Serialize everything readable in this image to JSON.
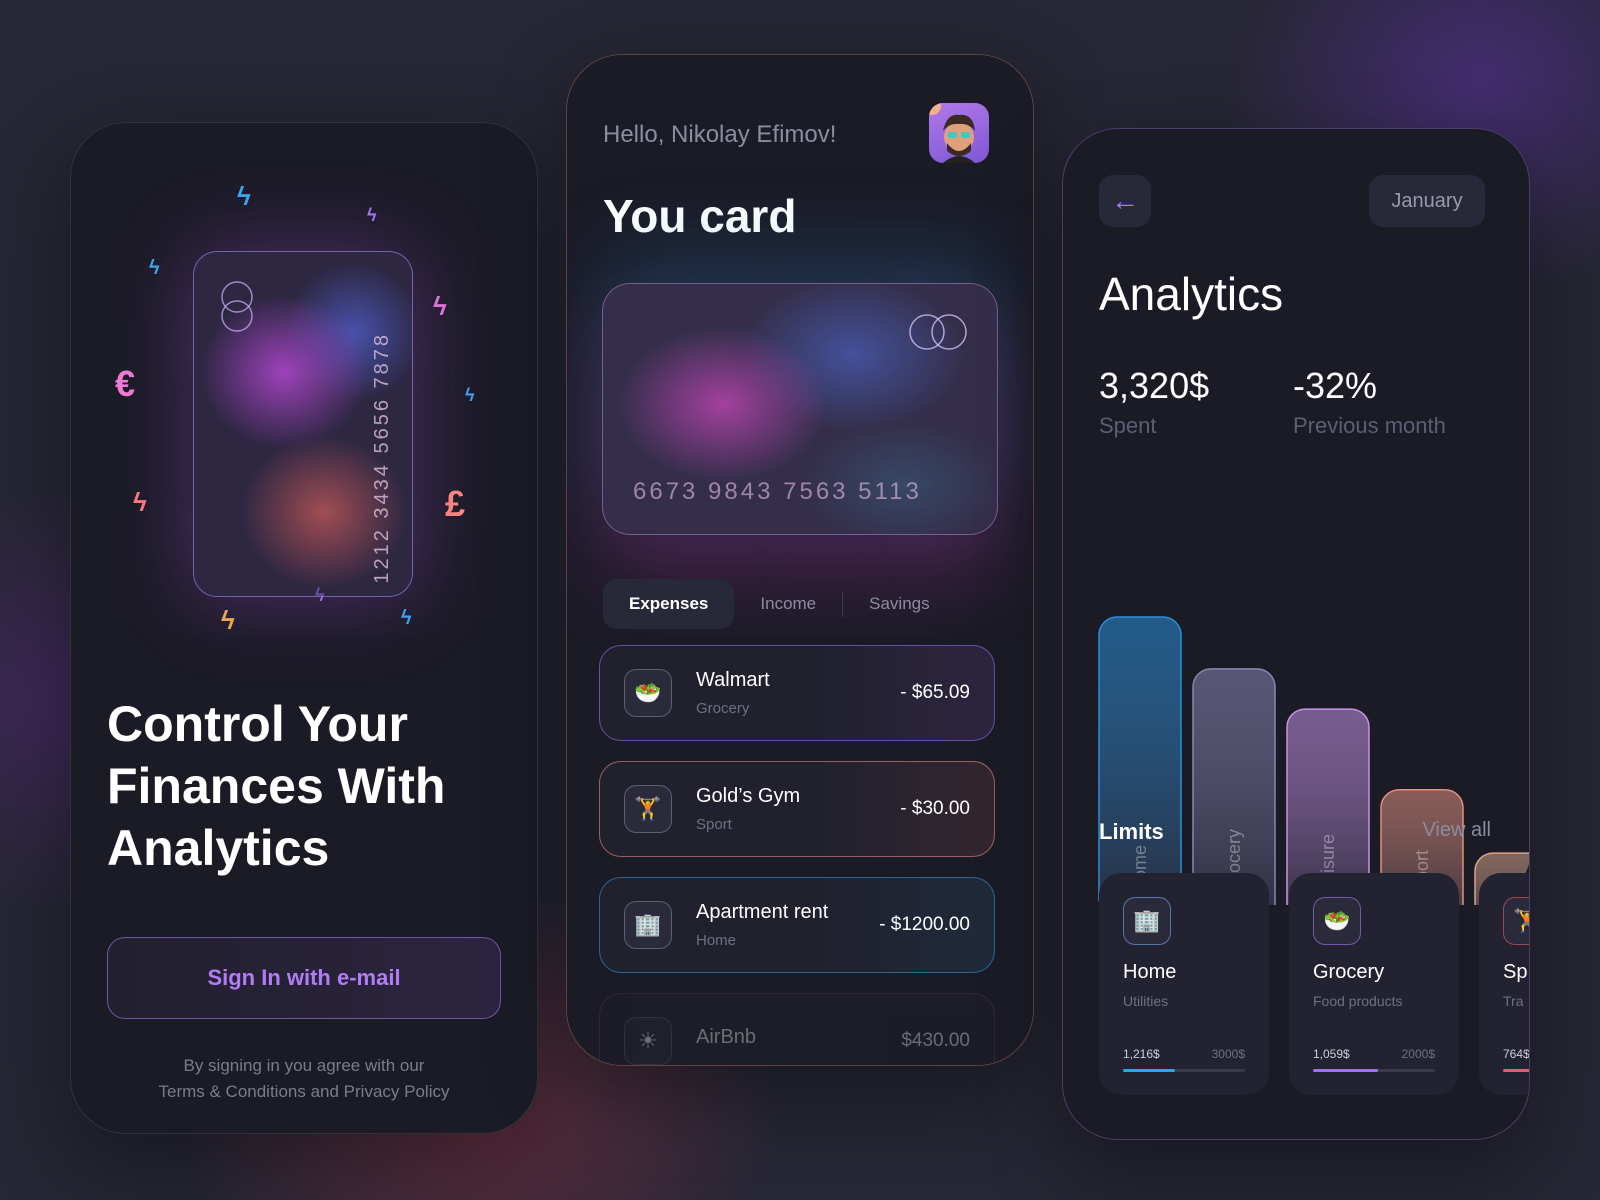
{
  "onboarding": {
    "card_number_vertical": "1212 3434 5656 7878",
    "currency_symbols": [
      "€",
      "£"
    ],
    "title_lines": [
      "Control Your",
      "Finances With",
      "Analytics"
    ],
    "signin_label": "Sign In with e-mail",
    "terms_line1": "By signing in you agree with our",
    "terms_line2": "Terms & Conditions and Privacy Policy"
  },
  "wallet": {
    "greeting": "Hello, Nikolay Efimov!",
    "title": "You card",
    "card_number": "6673 9843 7563 5113",
    "tabs": [
      {
        "label": "Expenses",
        "active": true
      },
      {
        "label": "Income",
        "active": false
      },
      {
        "label": "Savings",
        "active": false
      }
    ],
    "transactions": [
      {
        "name": "Walmart",
        "category": "Grocery",
        "amount": "- $65.09",
        "icon": "grocery-icon",
        "accent": "#8f6df0"
      },
      {
        "name": "Gold’s Gym",
        "category": "Sport",
        "amount": "- $30.00",
        "icon": "dumbbell-icon",
        "accent": "#e08a7c"
      },
      {
        "name": "Apartment rent",
        "category": "Home",
        "amount": "- $1200.00",
        "icon": "home-icon",
        "accent": "#2d8fd6"
      },
      {
        "name": "AirBnb",
        "category": "",
        "amount": "$430.00",
        "icon": "sun-icon",
        "accent": "#9a7a8a"
      }
    ]
  },
  "analytics": {
    "month": "January",
    "title": "Analytics",
    "spent_value": "3,320$",
    "spent_label": "Spent",
    "change_value": "-32%",
    "change_label": "Previous month",
    "limits_title": "Limits",
    "view_all": "View all",
    "limits": [
      {
        "title": "Home",
        "subtitle": "Utilities",
        "current": "1,216$",
        "max": "3000$",
        "fraction": 0.43,
        "color": "#2aa8e8",
        "icon": "home-icon"
      },
      {
        "title": "Grocery",
        "subtitle": "Food products",
        "current": "1,059$",
        "max": "2000$",
        "fraction": 0.53,
        "color": "#a270f0",
        "icon": "grocery-icon"
      },
      {
        "title": "Sp",
        "subtitle": "Tra",
        "current": "764$",
        "max": "",
        "fraction": 0.3,
        "color": "#e45d6e",
        "icon": "dumbbell-icon"
      }
    ]
  },
  "chart_data": {
    "type": "bar",
    "categories": [
      "Home",
      "Grocery",
      "Leisure",
      "Sport",
      ""
    ],
    "values": [
      100,
      82,
      68,
      40,
      18
    ],
    "colors": [
      "#2b8fd8",
      "#8a86b4",
      "#c792e6",
      "#e0907e",
      "#d8a48a"
    ],
    "title": "",
    "xlabel": "",
    "ylabel": "",
    "grid": false,
    "legend": "none"
  },
  "colors": {
    "accent": "#a57af5",
    "background": "#262634",
    "phone": "#1b1b26"
  }
}
